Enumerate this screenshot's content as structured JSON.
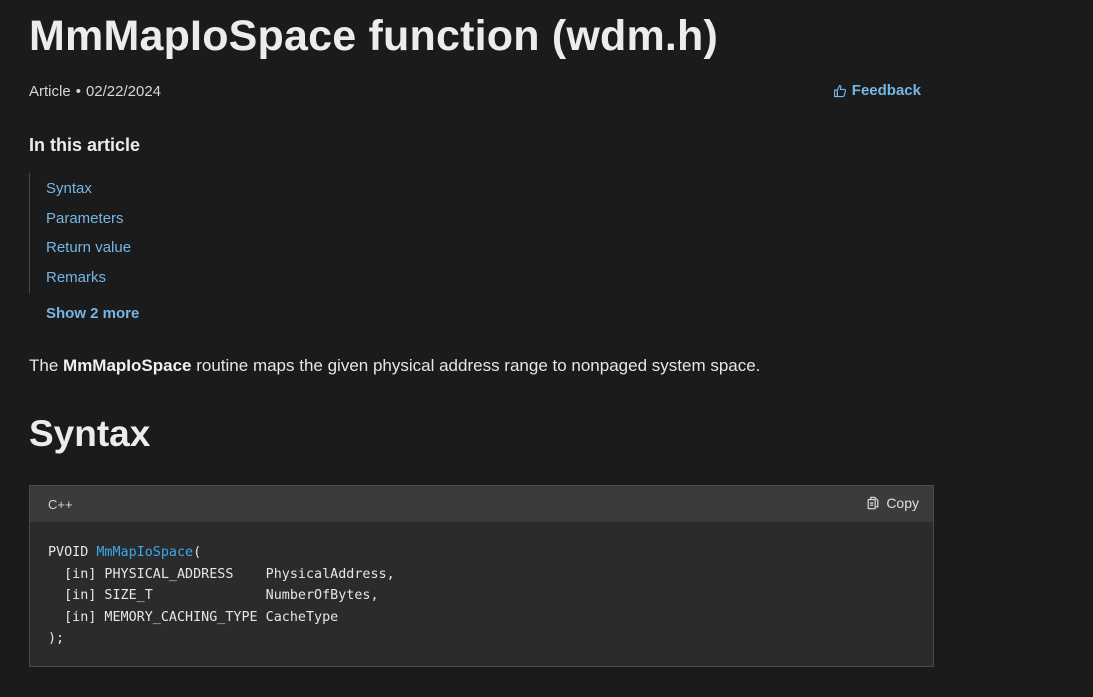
{
  "article": {
    "title": "MmMapIoSpace function (wdm.h)",
    "type": "Article",
    "separator": "•",
    "date": "02/22/2024",
    "feedback_label": "Feedback"
  },
  "toc": {
    "title": "In this article",
    "items": [
      {
        "label": "Syntax"
      },
      {
        "label": "Parameters"
      },
      {
        "label": "Return value"
      },
      {
        "label": "Remarks"
      }
    ],
    "show_more_label": "Show 2 more"
  },
  "intro": {
    "prefix": "The ",
    "function_name": "MmMapIoSpace",
    "suffix": " routine maps the given physical address range to nonpaged system space."
  },
  "syntax": {
    "heading": "Syntax",
    "language": "C++",
    "copy_label": "Copy",
    "code": {
      "return_type": "PVOID ",
      "function_name": "MmMapIoSpace",
      "open": "(",
      "params": [
        "  [in] PHYSICAL_ADDRESS    PhysicalAddress,",
        "  [in] SIZE_T              NumberOfBytes,",
        "  [in] MEMORY_CACHING_TYPE CacheType"
      ],
      "close": ");"
    }
  },
  "icons": {
    "feedback": "thumbs-up-icon",
    "copy": "copy-icon"
  },
  "colors": {
    "background": "#1b1b1b",
    "link": "#75b6e7",
    "code_function": "#3aa8f0",
    "code_background": "#2b2b2b",
    "code_header": "#3b3b3b"
  }
}
